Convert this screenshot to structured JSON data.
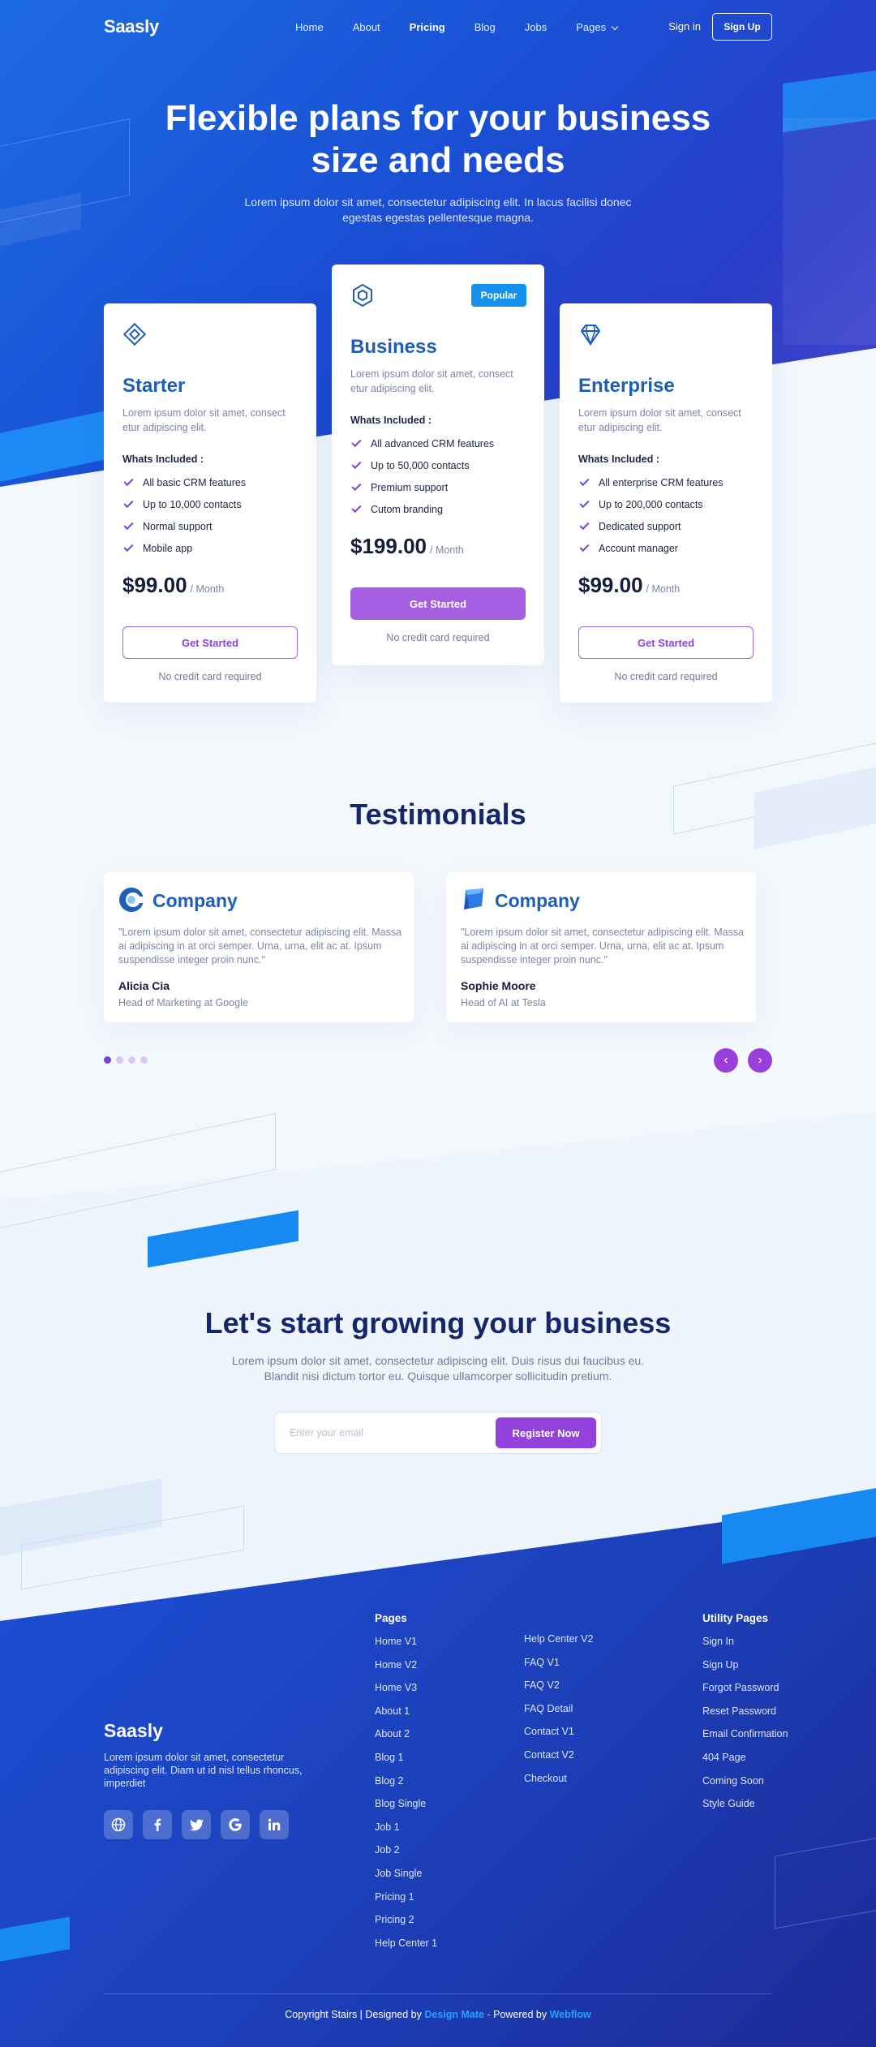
{
  "nav": {
    "logo": "Saasly",
    "links": [
      "Home",
      "About",
      "Pricing",
      "Blog",
      "Jobs",
      "Pages"
    ],
    "sign_in": "Sign in",
    "sign_up": "Sign Up"
  },
  "hero": {
    "title": "Flexible plans for your business size and needs",
    "subtitle": "Lorem ipsum dolor sit amet, consectetur adipiscing elit. In lacus facilisi donec egestas egestas pellentesque magna."
  },
  "plans": [
    {
      "name": "Starter",
      "icon": "diamond-outline-icon",
      "description": "Lorem ipsum dolor sit amet, consect etur adipiscing elit.",
      "included_label": "Whats Included :",
      "features": [
        "All basic CRM features",
        "Up to 10,000 contacts",
        "Normal support",
        "Mobile app"
      ],
      "price": "$99.00",
      "period": "/ Month",
      "button": "Get Started",
      "note": "No credit card required"
    },
    {
      "name": "Business",
      "icon": "hexagon-icon",
      "badge": "Popular",
      "description": "Lorem ipsum dolor sit amet, consect etur adipiscing elit.",
      "included_label": "Whats Included :",
      "features": [
        "All advanced CRM features",
        "Up to 50,000 contacts",
        "Premium support",
        "Cutom branding"
      ],
      "price": "$199.00",
      "period": "/ Month",
      "button": "Get Started",
      "note": "No credit card required"
    },
    {
      "name": "Enterprise",
      "icon": "gem-icon",
      "description": "Lorem ipsum dolor sit amet, consect etur adipiscing elit.",
      "included_label": "Whats Included :",
      "features": [
        "All enterprise CRM features",
        "Up to 200,000 contacts",
        "Dedicated support",
        "Account manager"
      ],
      "price": "$99.00",
      "period": "/ Month",
      "button": "Get Started",
      "note": "No credit card required"
    }
  ],
  "testimonials": {
    "title": "Testimonials",
    "items": [
      {
        "company": "Company",
        "quote": "\"Lorem ipsum dolor sit amet, consectetur adipiscing elit. Massa ai adipiscing in at orci semper. Urna, urna, elit ac at. Ipsum suspendisse integer proin nunc.\"",
        "name": "Alicia Cia",
        "role": "Head of Marketing at Google"
      },
      {
        "company": "Company",
        "quote": "\"Lorem ipsum dolor sit amet, consectetur adipiscing elit. Massa ai adipiscing in at orci semper. Urna, urna, elit ac at. Ipsum suspendisse integer proin nunc.\"",
        "name": "Sophie Moore",
        "role": "Head of AI at Tesla"
      }
    ],
    "prev_symbol": "‹",
    "next_symbol": "›"
  },
  "cta": {
    "title": "Let's start growing your business",
    "subtitle": "Lorem ipsum dolor sit amet, consectetur adipiscing elit. Duis risus dui faucibus eu. Blandit nisi dictum tortor eu. Quisque ullamcorper sollicitudin pretium.",
    "email_placeholder": "Enter your email",
    "button": "Register Now"
  },
  "footer": {
    "logo": "Saasly",
    "description": "Lorem ipsum dolor sit amet, consectetur adipiscing elit. Diam ut id nisl tellus rhoncus, imperdiet",
    "socials": [
      "globe-icon",
      "facebook-icon",
      "twitter-icon",
      "google-icon",
      "linkedin-icon"
    ],
    "pages_title": "Pages",
    "pages_col1": [
      "Home V1",
      "Home V2",
      "Home V3",
      "About 1",
      "About 2",
      "Blog 1",
      "Blog 2",
      "Blog Single",
      "Job 1",
      "Job 2",
      "Job Single",
      "Pricing 1",
      "Pricing 2",
      "Help Center 1"
    ],
    "pages_col2": [
      "Help Center V2",
      "FAQ V1",
      "FAQ V2",
      "FAQ Detail",
      "Contact V1",
      "Contact V2",
      "Checkout"
    ],
    "utility_title": "Utility Pages",
    "utility": [
      "Sign In",
      "Sign Up",
      "Forgot Password",
      "Reset Password",
      "Email Confirmation",
      "404 Page",
      "Coming Soon",
      "Style Guide"
    ],
    "copyright_pre": "Copyright Stairs | Designed by ",
    "designer": "Design Mate",
    "copyright_mid": " - Powered by ",
    "powered": "Webflow"
  },
  "colors": {
    "hero_blue": "#1a4fd4",
    "accent_purple": "#9341dc",
    "accent_cyan": "#1689f2",
    "heading_navy": "#15266b"
  }
}
